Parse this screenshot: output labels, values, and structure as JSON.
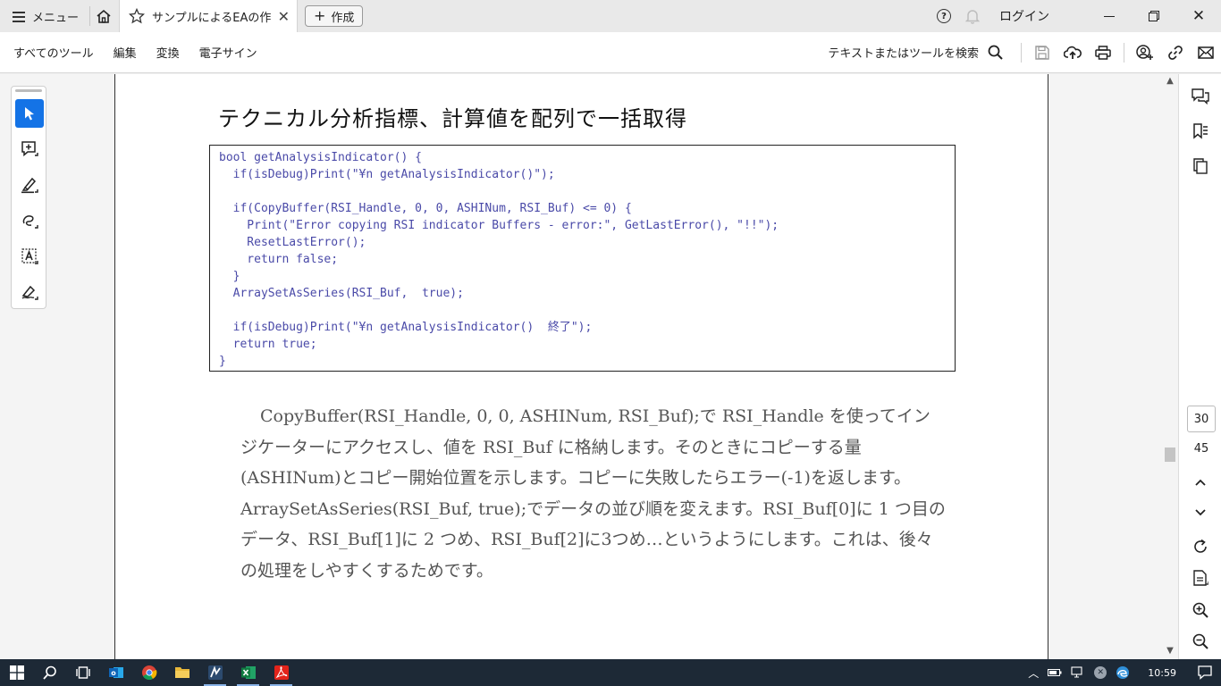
{
  "titlebar": {
    "menu_label": "メニュー",
    "tab_title": "サンプルによるEAの作成...",
    "new_tab_label": "作成",
    "login_label": "ログイン"
  },
  "toolbar": {
    "all_tools": "すべてのツール",
    "edit": "編集",
    "convert": "変換",
    "e_sign": "電子サイン",
    "search_label": "テキストまたはツールを検索"
  },
  "document": {
    "heading": "テクニカル分析指標、計算値を配列で一括取得",
    "code_lines": [
      "bool getAnalysisIndicator() {",
      "  if(isDebug)Print(\"¥n getAnalysisIndicator()\");",
      "",
      "  if(CopyBuffer(RSI_Handle, 0, 0, ASHINum, RSI_Buf) <= 0) {",
      "    Print(\"Error copying RSI indicator Buffers - error:\", GetLastError(), \"!!\");",
      "    ResetLastError();",
      "    return false;",
      "  }",
      "  ArraySetAsSeries(RSI_Buf,  true);",
      "",
      "  if(isDebug)Print(\"¥n getAnalysisIndicator()  終了\");",
      "  return true;",
      "}"
    ],
    "paragraph": "CopyBuffer(RSI_Handle, 0, 0, ASHINum, RSI_Buf);で RSI_Handle を使ってインジケーターにアクセスし、値を RSI_Buf に格納します。そのときにコピーする量(ASHINum)とコピー開始位置を示します。コピーに失敗したらエラー(-1)を返します。ArraySetAsSeries(RSI_Buf,  true);でデータの並び順を変えます。RSI_Buf[0]に 1 つ目のデータ、RSI_Buf[1]に 2 つめ、RSI_Buf[2]に3つめ…というようにします。これは、後々の処理をしやすくするためです。"
  },
  "pagination": {
    "current_page": "30",
    "total_pages": "45"
  },
  "taskbar": {
    "clock": "10:59"
  },
  "colors": {
    "accent": "#1473e6",
    "code_text": "#4a4aa8",
    "taskbar_bg": "#1d2936"
  }
}
